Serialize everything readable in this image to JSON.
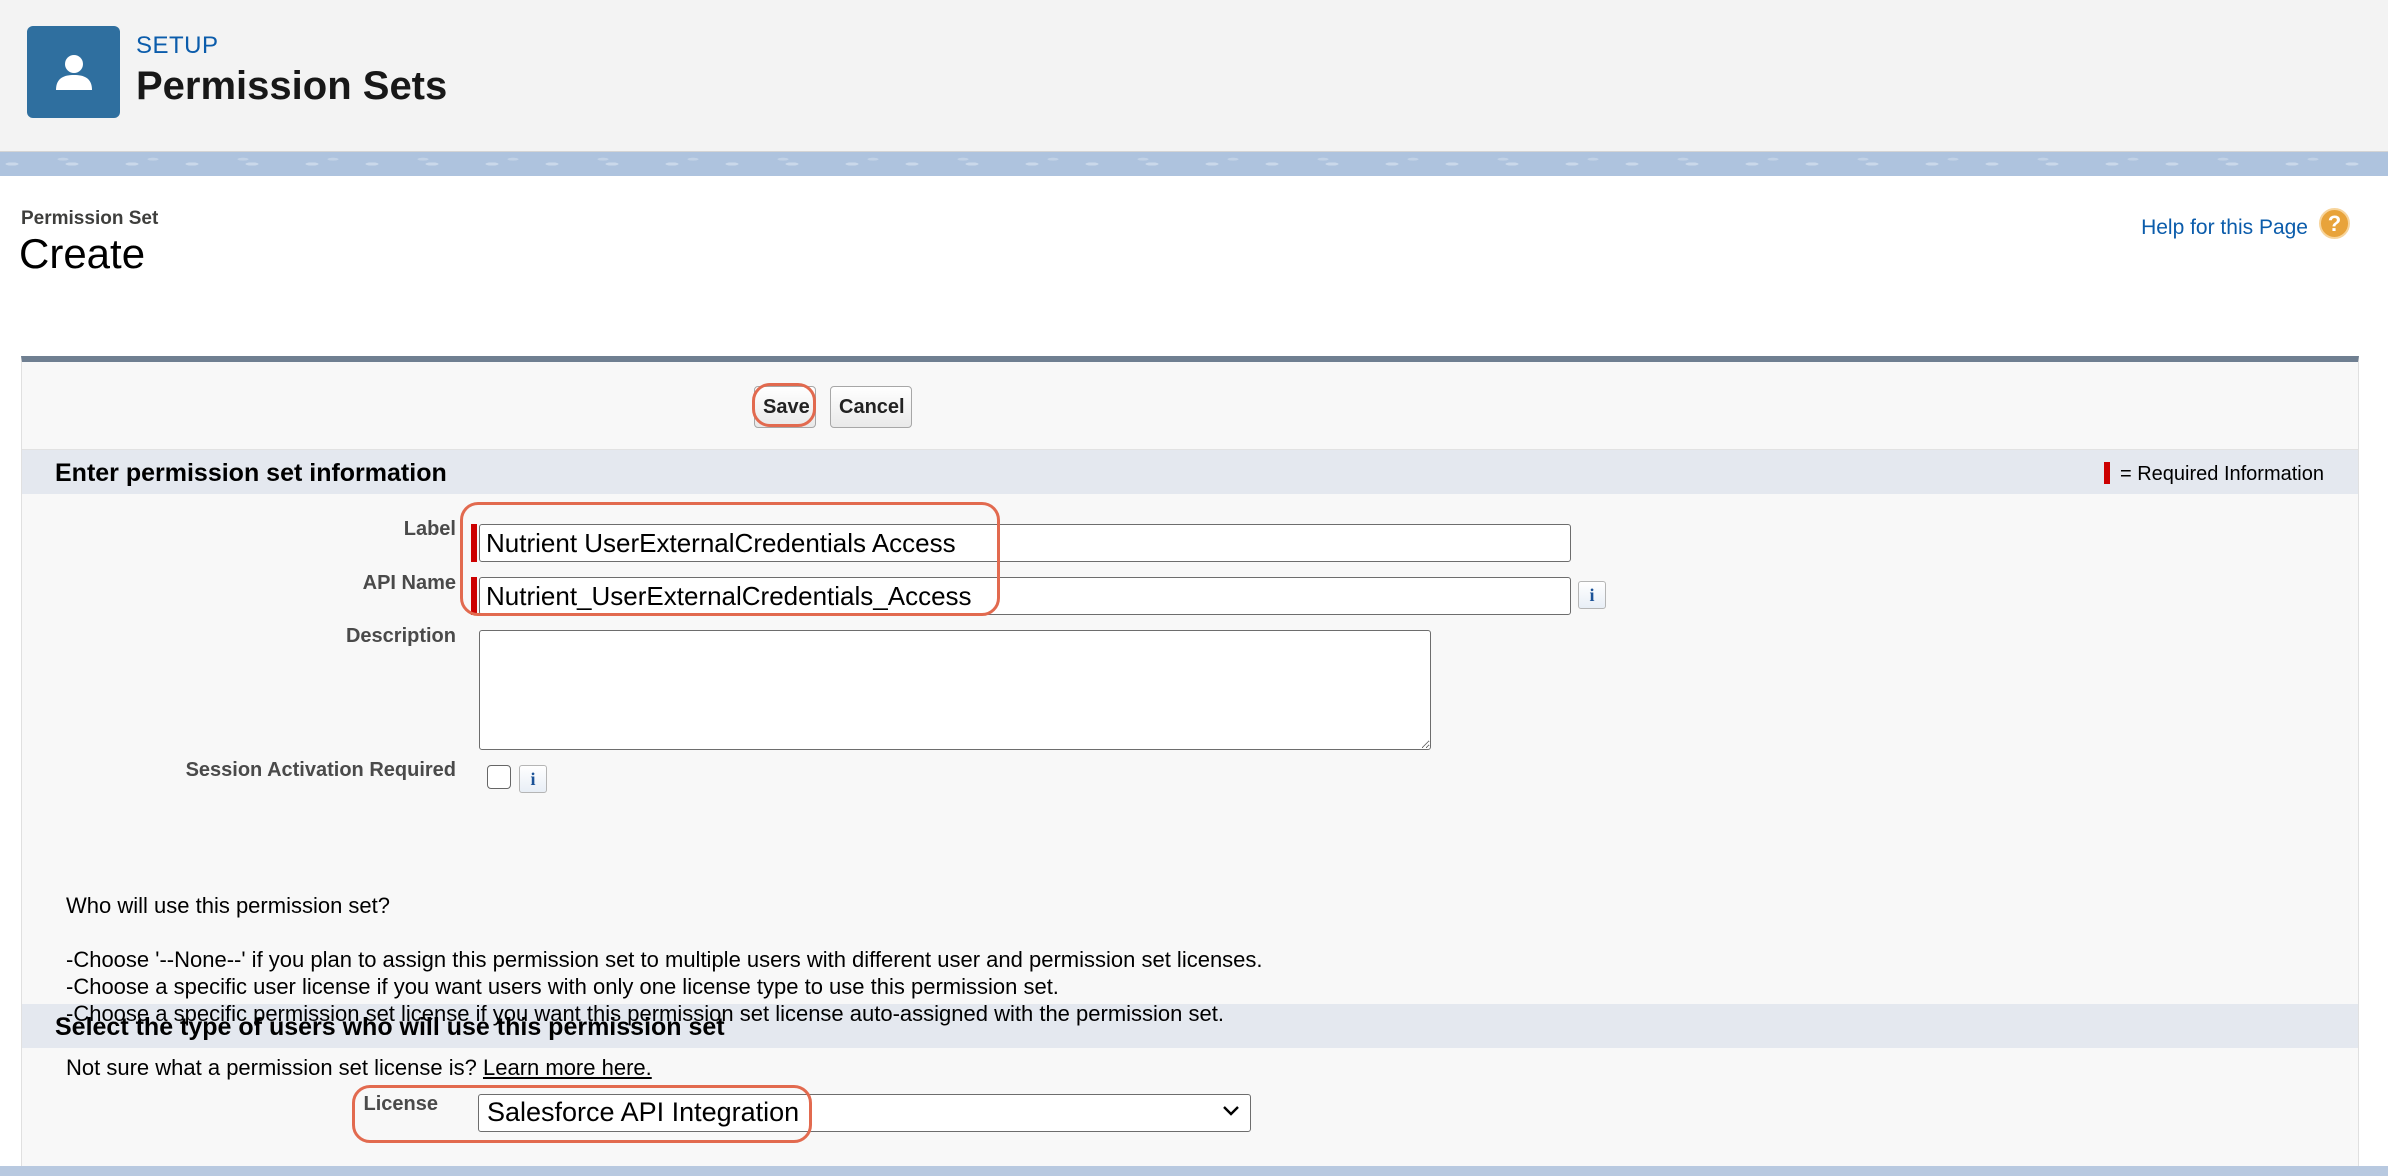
{
  "header": {
    "setup_label": "SETUP",
    "title": "Permission Sets",
    "icon": "user-icon"
  },
  "page": {
    "subtitle": "Permission Set",
    "title": "Create",
    "help_link": "Help for this Page",
    "help_icon": "question-icon"
  },
  "toolbar": {
    "save_label": "Save",
    "cancel_label": "Cancel"
  },
  "section_info": {
    "title": "Enter permission set information",
    "required_legend": "= Required Information",
    "fields": {
      "label": {
        "label": "Label",
        "value": "Nutrient UserExternalCredentials Access"
      },
      "api_name": {
        "label": "API Name",
        "value": "Nutrient_UserExternalCredentials_Access"
      },
      "description": {
        "label": "Description",
        "value": ""
      },
      "session_activation": {
        "label": "Session Activation Required",
        "checked": false
      }
    }
  },
  "section_users": {
    "title": "Select the type of users who will use this permission set",
    "question": "Who will use this permission set?",
    "bullets": [
      "-Choose '--None--' if you plan to assign this permission set to multiple users with different user and permission set licenses.",
      "-Choose a specific user license if you want users with only one license type to use this permission set.",
      "-Choose a specific permission set license if you want this permission set license auto-assigned with the permission set."
    ],
    "not_sure": "Not sure what a permission set license is?",
    "learn_more": "Learn more here.",
    "license_label": "License",
    "license_value": "Salesforce API Integration"
  },
  "colors": {
    "brand_icon_bg": "#2f6f9f",
    "link": "#0b5cab",
    "required": "#cc0000",
    "highlight": "#e26a4f"
  }
}
